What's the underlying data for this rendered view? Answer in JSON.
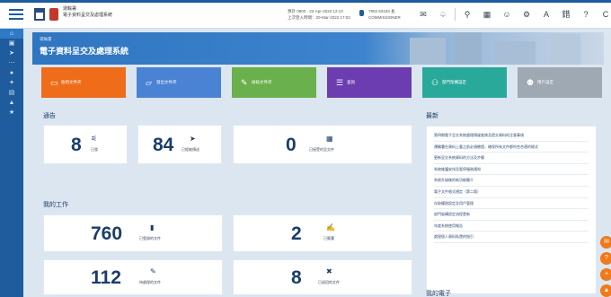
{
  "header": {
    "brand_line1": "運輸署",
    "brand_line2": "電子資料呈交及處理系統",
    "timestamp1": "預計 0800 · 22-Apr-2022 12:13",
    "timestamp2": "上次登入時間：20-Mar-2022 17:03",
    "user_name": "7802 83193 長",
    "user_role": "COMMISSIONER",
    "icons": [
      "mail-icon",
      "bell-icon",
      "search-icon",
      "calendar-icon",
      "user-settings-icon",
      "gear-icon",
      "A",
      "錯",
      "?",
      "C",
      "中"
    ]
  },
  "sidebar": {
    "items": [
      "home-icon",
      "inbox-icon",
      "send-icon",
      "share-icon",
      "person-icon",
      "settings-icon",
      "grid-icon",
      "chart-icon",
      "star-icon"
    ]
  },
  "banner": {
    "subtitle": "運輸署",
    "title": "電子資料呈交及處理系統"
  },
  "tiles": [
    {
      "label": "收到文件夾",
      "color": "#ef6c1a",
      "icon": "▭"
    },
    {
      "label": "發出文件夾",
      "color": "#4a83d4",
      "icon": "▱"
    },
    {
      "label": "檢核文件夾",
      "color": "#6ab04c",
      "icon": "✎"
    },
    {
      "label": "查詢",
      "color": "#6c3db0",
      "icon": "☰"
    },
    {
      "label": "部門架構設定",
      "color": "#29a99a",
      "icon": "⚇"
    },
    {
      "label": "用戶設定",
      "color": "#9fa9b4",
      "icon": "⚉"
    }
  ],
  "stats": {
    "title": "通告",
    "items": [
      {
        "value": "8",
        "label": "已發"
      },
      {
        "value": "84",
        "label": "已經被傳送"
      },
      {
        "value": "0",
        "label": "已接受的呈交件"
      }
    ]
  },
  "worklist": {
    "title": "我的工作",
    "items": [
      {
        "value": "760",
        "label": "已登錄的文件"
      },
      {
        "value": "2",
        "label": "已簽署"
      },
      {
        "value": "112",
        "label": "待處理的文件"
      },
      {
        "value": "8",
        "label": "已退回的文件"
      }
    ]
  },
  "news": {
    "title": "最新",
    "items": [
      "第四期電子呈交系統處理傳媒查詢及提交資料的注意事項",
      "運輸署在資料上載之前必須驗證，確保所有文件都符合合適的格式",
      "更新呈交系統資料的方法及步驟",
      "系統維護安排及暫停服務通知",
      "系統升級後的新功能簡介",
      "電子文件格式規定（第二版）",
      "存取權限設定及用戶管理",
      "部門架構設定流程更新",
      "年度系統使用報告",
      "處理個人資料私隱的指引"
    ]
  },
  "section2": {
    "title": "我的電子"
  },
  "fabs": [
    "chat-icon",
    "help-icon",
    "plus-icon",
    "up-icon"
  ]
}
